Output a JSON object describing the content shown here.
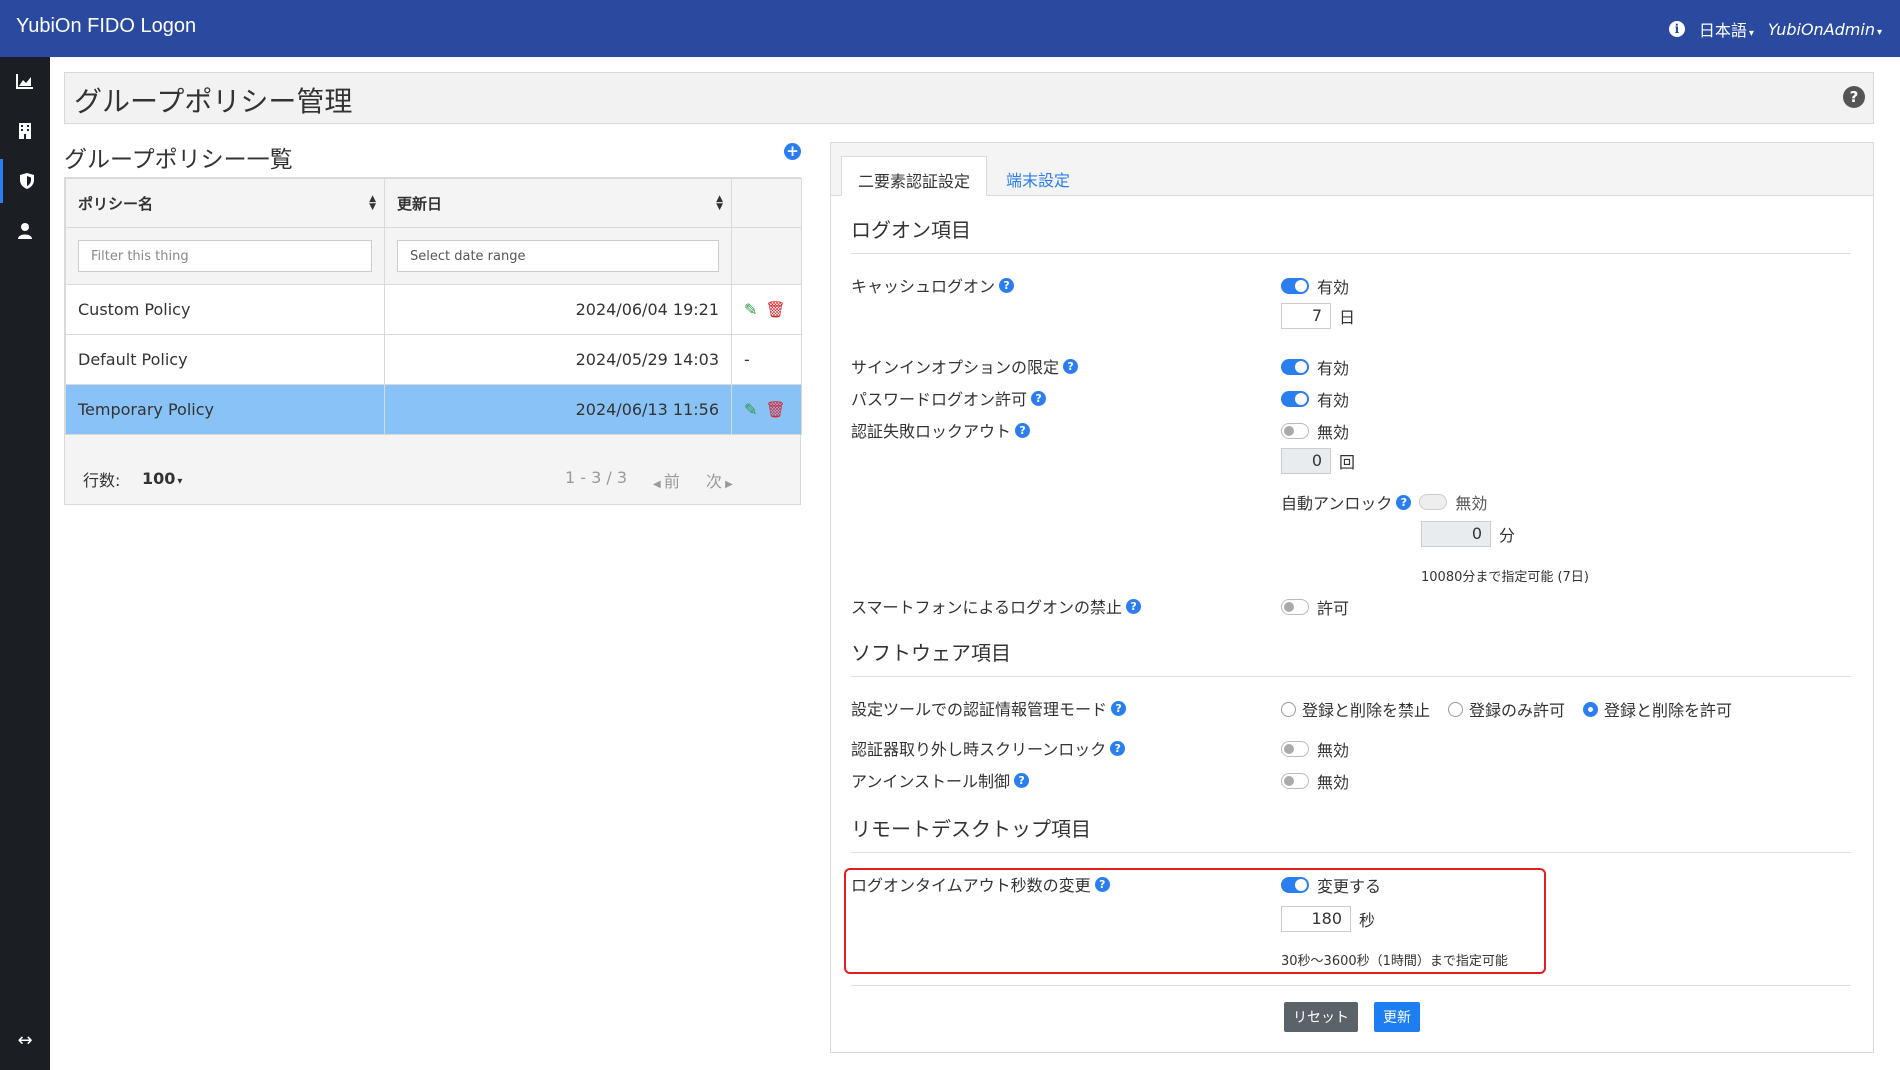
{
  "header": {
    "brand": "YubiOn FIDO Logon",
    "language": "日本語",
    "user": "YubiOnAdmin"
  },
  "page": {
    "title": "グループポリシー管理",
    "list_title": "グループポリシー一覧"
  },
  "table": {
    "columns": [
      "ポリシー名",
      "更新日"
    ],
    "filter_placeholder": "Filter this thing",
    "date_placeholder": "Select date range",
    "rows": [
      {
        "name": "Custom Policy",
        "date": "2024/06/04 19:21",
        "action": ""
      },
      {
        "name": "Default Policy",
        "date": "2024/05/29 14:03",
        "action": "-"
      },
      {
        "name": "Temporary Policy",
        "date": "2024/06/13 11:56",
        "action": ""
      }
    ],
    "rows_label": "行数:",
    "rows_value": "100",
    "range": "1 - 3 / 3",
    "prev": "前",
    "next": "次"
  },
  "tabs": {
    "active": "二要素認証設定",
    "other": "端末設定"
  },
  "logon": {
    "section": "ログオン項目",
    "cache_label": "キャッシュログオン",
    "cache_state": "有効",
    "cache_days": "7",
    "cache_unit": "日",
    "signin_label": "サインインオプションの限定",
    "signin_state": "有効",
    "password_label": "パスワードログオン許可",
    "password_state": "有効",
    "lockout_label": "認証失敗ロックアウト",
    "lockout_state": "無効",
    "lockout_count": "0",
    "lockout_unit": "回",
    "unlock_label": "自動アンロック",
    "unlock_state": "無効",
    "unlock_minutes": "0",
    "unlock_unit": "分",
    "unlock_hint": "10080分まで指定可能 (7日)",
    "smartphone_label": "スマートフォンによるログオンの禁止",
    "smartphone_state": "許可"
  },
  "software": {
    "section": "ソフトウェア項目",
    "mode_label": "設定ツールでの認証情報管理モード",
    "mode_options": [
      "登録と削除を禁止",
      "登録のみ許可",
      "登録と削除を許可"
    ],
    "mode_selected": "登録と削除を許可",
    "screenlock_label": "認証器取り外し時スクリーンロック",
    "screenlock_state": "無効",
    "uninstall_label": "アンインストール制御",
    "uninstall_state": "無効"
  },
  "remote": {
    "section": "リモートデスクトップ項目",
    "timeout_label": "ログオンタイムアウト秒数の変更",
    "timeout_state": "変更する",
    "timeout_value": "180",
    "timeout_unit": "秒",
    "timeout_hint": "30秒～3600秒（1時間）まで指定可能"
  },
  "buttons": {
    "reset": "リセット",
    "update": "更新"
  }
}
